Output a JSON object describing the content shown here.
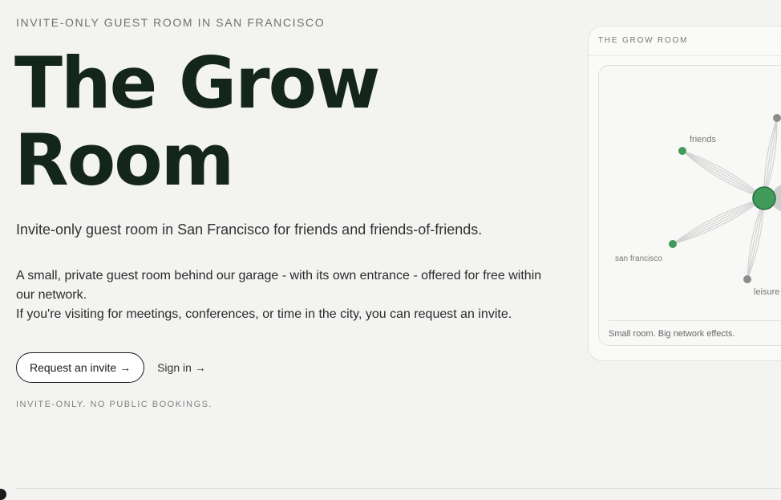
{
  "hero": {
    "eyebrow": "INVITE-ONLY GUEST ROOM IN SAN FRANCISCO",
    "title_line1": "The Grow",
    "title_line2": "Room",
    "lede": "Invite-only guest room in San Francisco for friends and friends-of-friends.",
    "body_line1": "A small, private guest room behind our garage - with its own entrance - offered for free within our network.",
    "body_line2": "If you're visiting for meetings, conferences, or time in the city, you can request an invite.",
    "note": "INVITE-ONLY. NO PUBLIC BOOKINGS."
  },
  "actions": {
    "request_invite": "Request an invite →",
    "sign_in": "Sign in →"
  },
  "card": {
    "title": "THE GROW ROOM",
    "caption": "Small room. Big network effects.",
    "graph": {
      "labels": {
        "friends": "friends",
        "san_francisco": "san francisco",
        "leisure": "leisure"
      },
      "colors": {
        "hub": "#3f9a5c",
        "node_green": "#3f9a5c",
        "node_gray": "#8c8c8c",
        "edge": "#d2d2d2"
      }
    }
  }
}
